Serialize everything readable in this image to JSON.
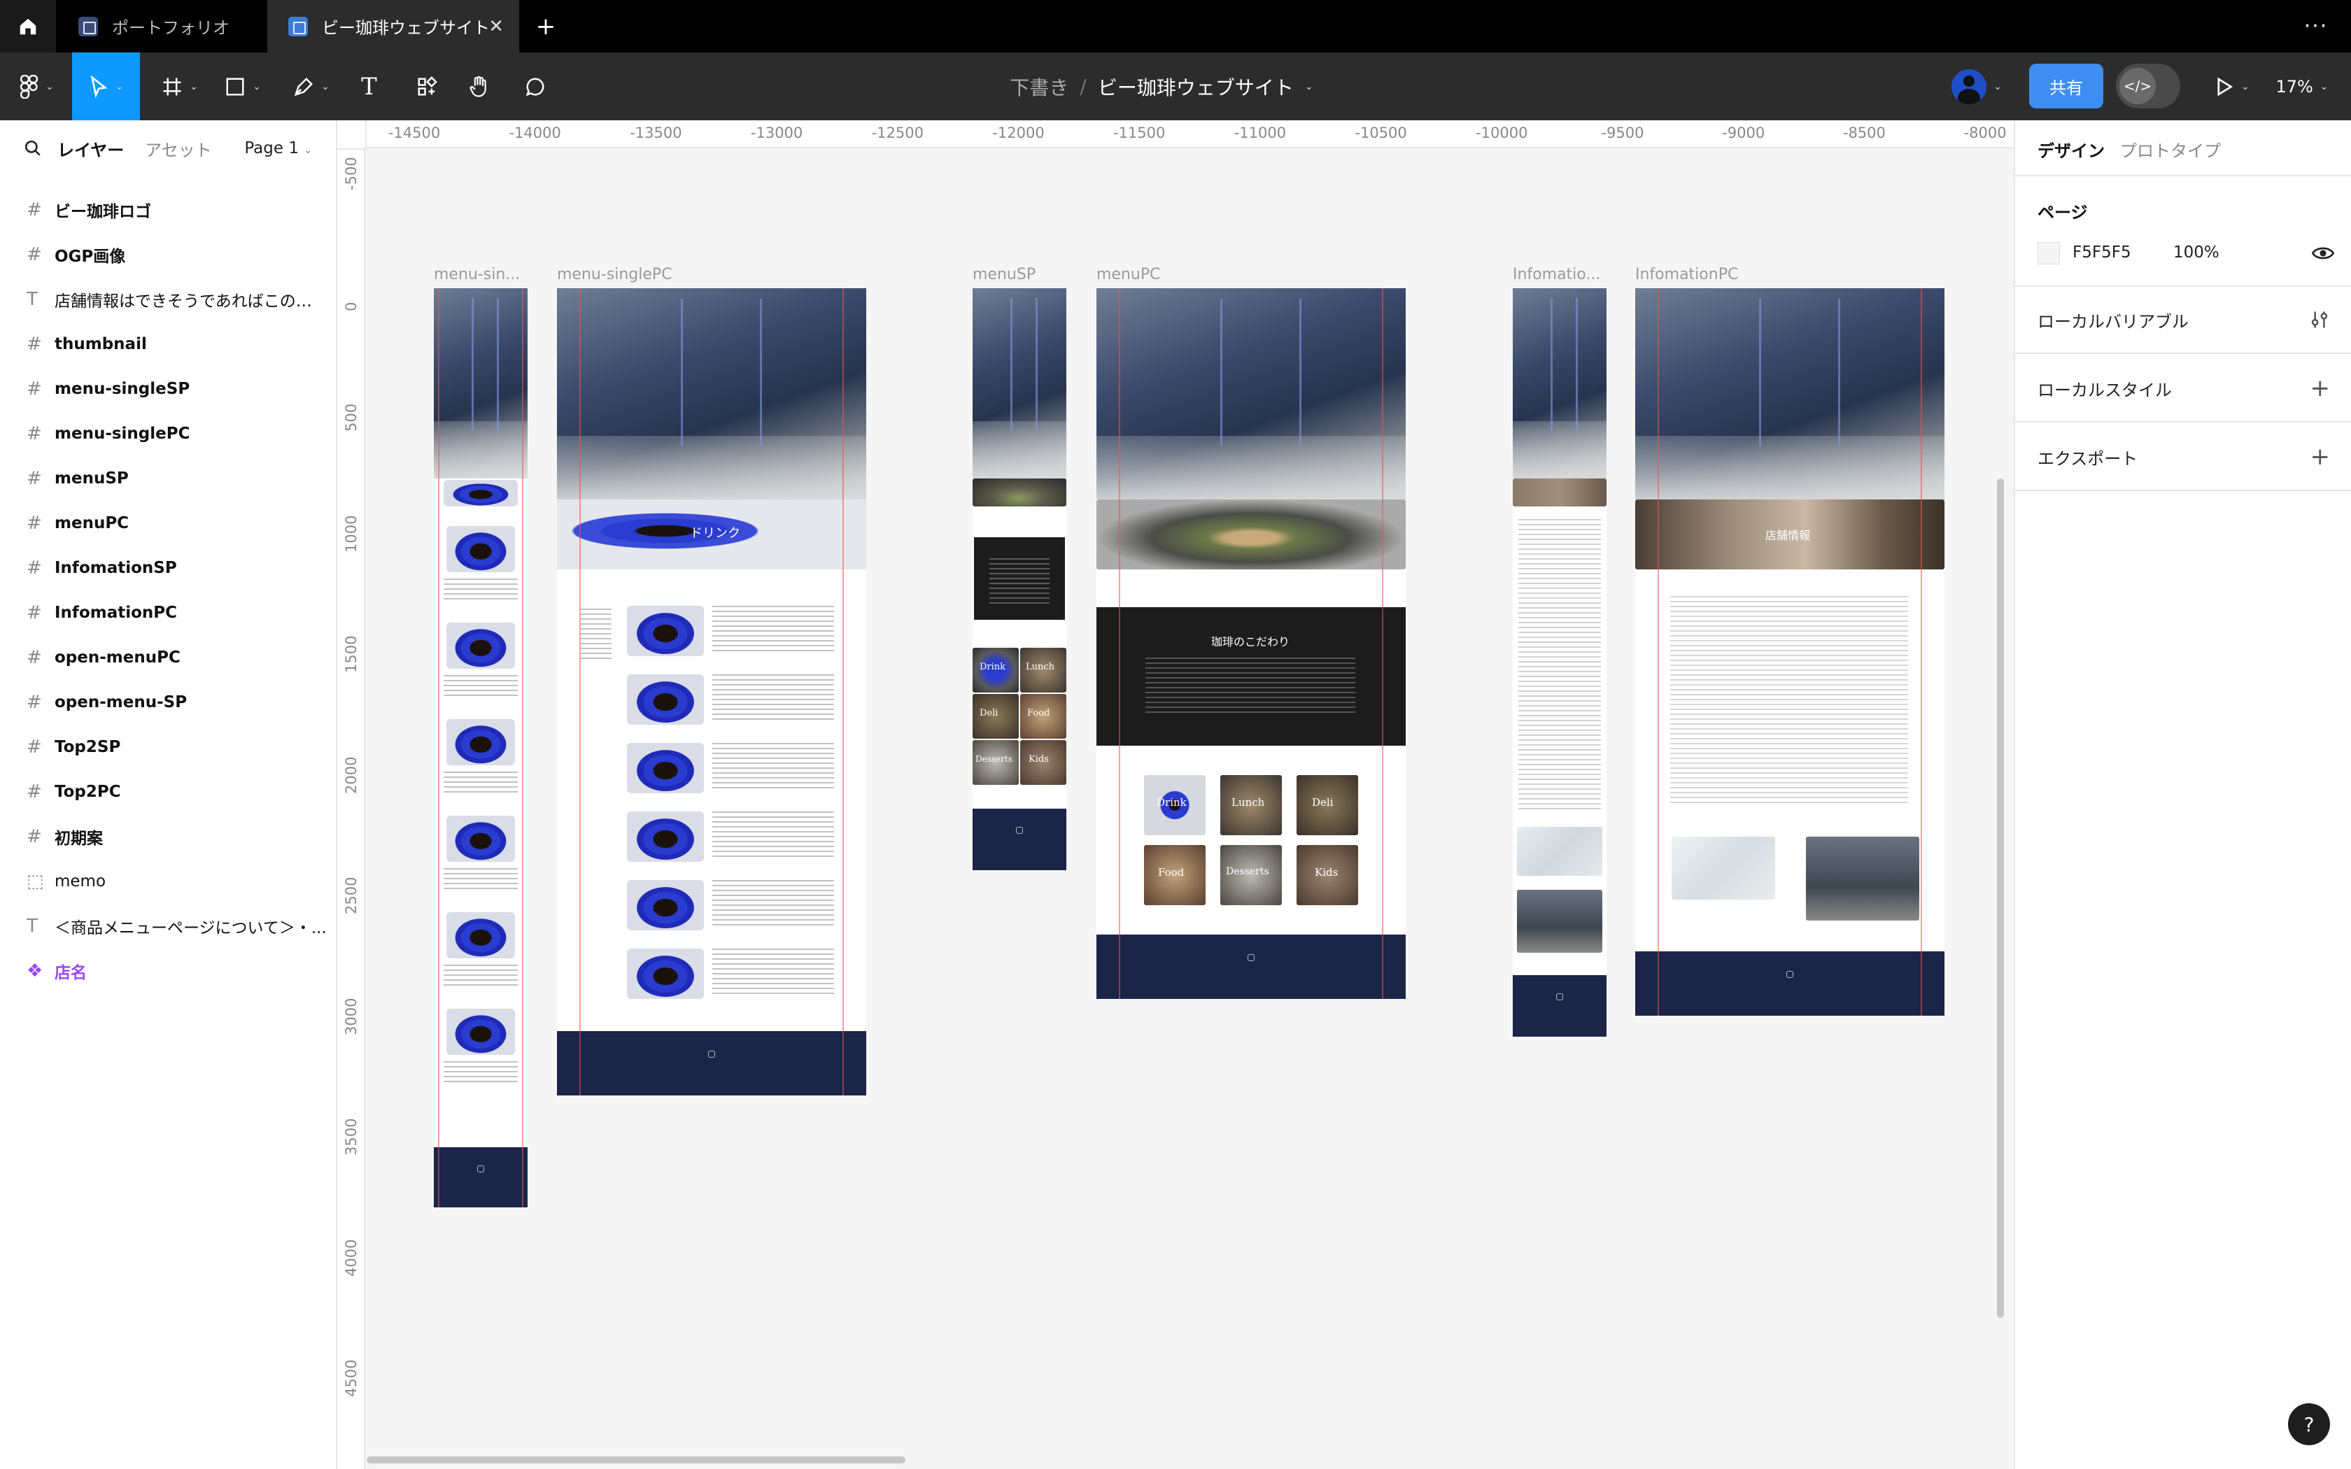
{
  "tabs": [
    {
      "label": "ポートフォリオ",
      "color": "#3a4b7a"
    },
    {
      "label": "ビー珈琲ウェブサイト",
      "color": "#3d7bd8"
    }
  ],
  "toolbar": {
    "breadcrumb_parent": "下書き",
    "breadcrumb_sep": "/",
    "file_name": "ビー珈琲ウェブサイト",
    "share_label": "共有",
    "zoom": "17%"
  },
  "left_panel": {
    "tab_layers": "レイヤー",
    "tab_assets": "アセット",
    "page": "Page 1",
    "layers": [
      {
        "icon": "#",
        "name": "ビー珈琲ロゴ",
        "bold": true
      },
      {
        "icon": "#",
        "name": "OGP画像",
        "bold": true
      },
      {
        "icon": "T",
        "name": "店舗情報はできそうであればこのまま",
        "bold": false
      },
      {
        "icon": "#",
        "name": "thumbnail",
        "bold": true
      },
      {
        "icon": "#",
        "name": "menu-singleSP",
        "bold": true
      },
      {
        "icon": "#",
        "name": "menu-singlePC",
        "bold": true
      },
      {
        "icon": "#",
        "name": "menuSP",
        "bold": true
      },
      {
        "icon": "#",
        "name": "menuPC",
        "bold": true
      },
      {
        "icon": "#",
        "name": "InfomationSP",
        "bold": true
      },
      {
        "icon": "#",
        "name": "InfomationPC",
        "bold": true
      },
      {
        "icon": "#",
        "name": "open-menuPC",
        "bold": true
      },
      {
        "icon": "#",
        "name": "open-menu-SP",
        "bold": true
      },
      {
        "icon": "#",
        "name": "Top2SP",
        "bold": true
      },
      {
        "icon": "#",
        "name": "Top2PC",
        "bold": true
      },
      {
        "icon": "#",
        "name": "初期案",
        "bold": true
      },
      {
        "icon": "⬚",
        "name": "memo",
        "bold": false
      },
      {
        "icon": "T",
        "name": "＜商品メニューページについて＞・...",
        "bold": false
      },
      {
        "icon": "❖",
        "name": "店名",
        "bold": false,
        "purple": true
      }
    ]
  },
  "ruler": {
    "h": [
      "-14500",
      "-14000",
      "-13500",
      "-13000",
      "-12500",
      "-12000",
      "-11500",
      "-11000",
      "-10500",
      "-10000",
      "-9500",
      "-9000",
      "-8500",
      "-8000"
    ],
    "v": [
      "-500",
      "0",
      "500",
      "1000",
      "1500",
      "2000",
      "2500",
      "3000",
      "3500",
      "4000",
      "4500"
    ]
  },
  "frames": {
    "menu_single_sp": "menu-sin...",
    "menu_single_pc": "menu-singlePC",
    "menu_sp": "menuSP",
    "menu_pc": "menuPC",
    "info_sp": "Infomatio...",
    "info_pc": "InfomationPC",
    "drink_title": "ドリンク",
    "kodawari_title": "珈琲のこだわり",
    "shop_info_title": "店舗情報",
    "menu_cats": [
      "Drink",
      "Lunch",
      "Deli",
      "Food",
      "Desserts",
      "Kids"
    ]
  },
  "right_panel": {
    "tab_design": "デザイン",
    "tab_prototype": "プロトタイプ",
    "page_section": "ページ",
    "bg_hex": "F5F5F5",
    "bg_opacity": "100%",
    "local_variables": "ローカルバリアブル",
    "local_styles": "ローカルスタイル",
    "export": "エクスポート"
  },
  "colors": {
    "accent": "#0d99ff",
    "share": "#3d8ef0",
    "navy": "#1b2547",
    "purple": "#9747ff"
  }
}
